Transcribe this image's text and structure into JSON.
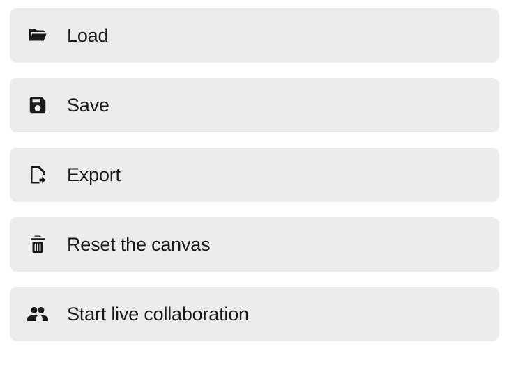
{
  "menu": {
    "items": [
      {
        "label": "Load"
      },
      {
        "label": "Save"
      },
      {
        "label": "Export"
      },
      {
        "label": "Reset the canvas"
      },
      {
        "label": "Start live collaboration"
      }
    ]
  }
}
